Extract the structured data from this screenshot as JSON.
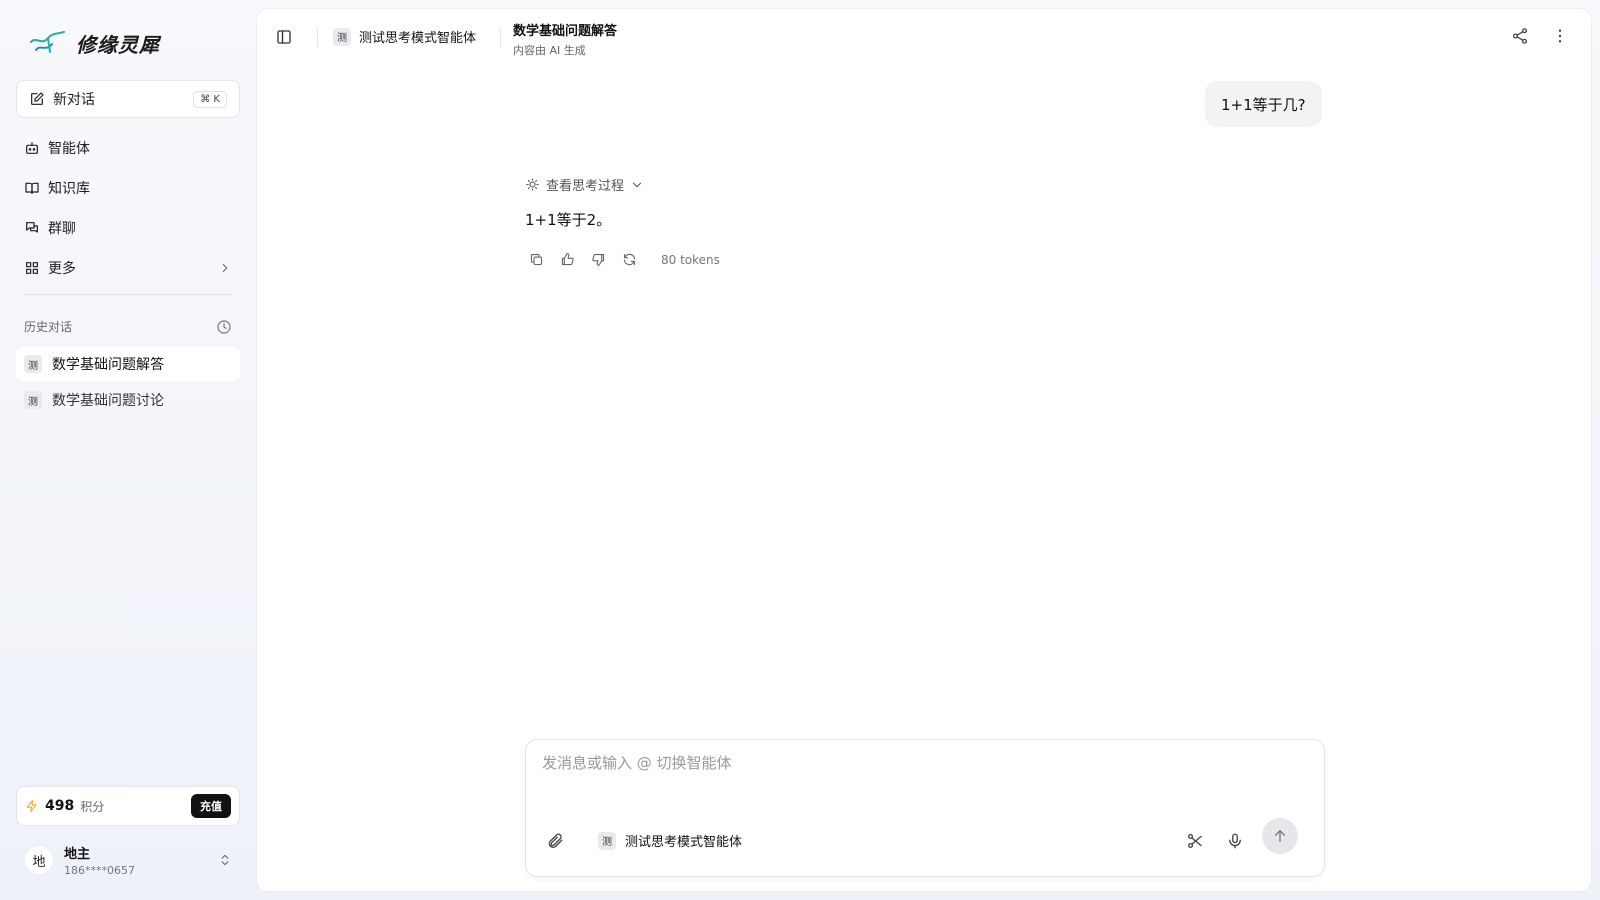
{
  "app": {
    "logo_text": "修缘灵犀",
    "logo_accent_color": "#1fb39a"
  },
  "sidebar": {
    "new_chat_label": "新对话",
    "new_chat_shortcut": "⌘ K",
    "nav": [
      {
        "label": "智能体",
        "icon": "robot-icon"
      },
      {
        "label": "知识库",
        "icon": "book-icon"
      },
      {
        "label": "群聊",
        "icon": "chat-bubbles-icon"
      },
      {
        "label": "更多",
        "icon": "grid-icon"
      }
    ],
    "history_title": "历史对话",
    "history": [
      {
        "badge": "测",
        "title": "数学基础问题解答",
        "active": true
      },
      {
        "badge": "测",
        "title": "数学基础问题讨论",
        "active": false
      }
    ],
    "credits": {
      "value": "498",
      "unit": "积分",
      "recharge_label": "充值"
    },
    "user": {
      "avatar_text": "地",
      "name": "地主",
      "phone": "186****0657"
    }
  },
  "header": {
    "agent_badge": "测",
    "agent_name": "测试思考模式智能体",
    "conversation_title": "数学基础问题解答",
    "conversation_subtitle": "内容由 AI 生成"
  },
  "chat": {
    "user_message": "1+1等于几?",
    "thinking_label": "查看思考过程",
    "answer": "1+1等于2。",
    "tokens": "80 tokens"
  },
  "composer": {
    "placeholder": "发消息或输入 @ 切换智能体",
    "value": "",
    "agent_badge": "测",
    "agent_name": "测试思考模式智能体"
  },
  "colors": {
    "credits_bolt": "#f5a623",
    "recharge_bg": "#111111"
  }
}
